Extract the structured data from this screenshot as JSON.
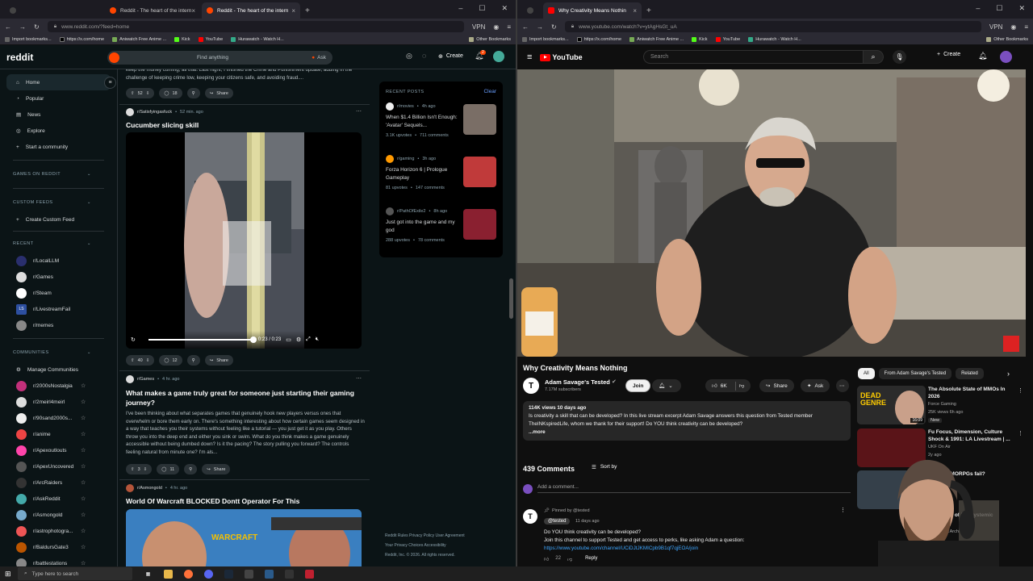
{
  "left_browser": {
    "tabs": [
      {
        "title": "Reddit - The heart of the intern"
      },
      {
        "title": "Reddit - The heart of the intern"
      }
    ],
    "url": "www.reddit.com/?feed=home",
    "vpn": "VPN",
    "bookmarks": [
      "Import bookmarks...",
      "https://x.com/home",
      "Aniwatch Free Anime ...",
      "Kick",
      "YouTube",
      "Hurawatch - Watch H..."
    ],
    "other_bookmarks": "Other Bookmarks"
  },
  "reddit": {
    "logo": "reddit",
    "search_placeholder": "Find anything",
    "ask_label": "Ask",
    "create_label": "Create",
    "notif_count": "2",
    "nav": [
      {
        "label": "Home",
        "icon": "home-icon"
      },
      {
        "label": "Popular",
        "icon": "popular-icon"
      },
      {
        "label": "News",
        "icon": "news-icon"
      },
      {
        "label": "Explore",
        "icon": "explore-icon"
      },
      {
        "label": "Start a community",
        "icon": "plus-icon"
      }
    ],
    "sections": {
      "games": "GAMES ON REDDIT",
      "custom": "CUSTOM FEEDS",
      "create_feed": "Create Custom Feed",
      "recent": "RECENT",
      "communities": "COMMUNITIES",
      "manage": "Manage Communities"
    },
    "recent_subs": [
      "r/LocalLLM",
      "r/Games",
      "r/Steam",
      "r/LivestreamFail",
      "r/memes"
    ],
    "communities": [
      "r/2000sNostalgia",
      "r/2meirl4meirl",
      "r/90sand2000s...",
      "r/anime",
      "r/Apexoutlouts",
      "r/ApexUncovered",
      "r/ArcRaiders",
      "r/AskReddit",
      "r/Asmongold",
      "r/astrophotogra...",
      "r/BaldursGate3",
      "r/battlestations"
    ],
    "posts": [
      {
        "text": "keep the money coming, all that. Last night, I finished the Crime and Punishment update, adding in the challenge of keeping crime low, keeping your citizens safe, and avoiding fraud....",
        "votes": "52",
        "comments": "18",
        "share": "Share"
      },
      {
        "sub": "r/Satisfyingasfuck",
        "time": "52 min. ago",
        "title": "Cucumber slicing skill",
        "video_time": "0:23 / 0:23",
        "progress": 1.0,
        "votes": "40",
        "comments": "12",
        "share": "Share"
      },
      {
        "sub": "r/Games",
        "time": "4 hr. ago",
        "title": "What makes a game truly great for someone just starting their gaming journey?",
        "text": "I've been thinking about what separates games that genuinely hook new players versus ones that overwhelm or bore them early on. There's something interesting about how certain games seem designed in a way that teaches you their systems without feeling like a tutorial — you just get it as you play. Others throw you into the deep end and either you sink or swim. What do you think makes a game genuinely accessible without being dumbed down? Is it the pacing? The story pulling you forward? The controls feeling natural from minute one? I'm als...",
        "votes": "3",
        "comments": "11",
        "share": "Share"
      },
      {
        "sub": "r/Asmongold",
        "time": "4 hr. ago",
        "title": "World Of Warcraft BLOCKED Dontt Operator For This",
        "thumb_text": "WARCRAFT"
      }
    ],
    "recent_panel": {
      "heading": "RECENT POSTS",
      "clear": "Clear",
      "items": [
        {
          "sub": "r/movies",
          "time": "4h ago",
          "title": "When $1.4 Billion Isn't Enough: 'Avatar' Sequels...",
          "upvotes": "3.1K upvotes",
          "comments": "711 comments"
        },
        {
          "sub": "r/gaming",
          "time": "3h ago",
          "title": "Forza Horizon 6 | Prologue Gameplay",
          "upvotes": "81 upvotes",
          "comments": "147 comments"
        },
        {
          "sub": "r/PathOfExile2",
          "time": "8h ago",
          "title": "Just got into the game and my god",
          "upvotes": "288 upvotes",
          "comments": "78 comments"
        }
      ]
    },
    "footer": {
      "line1": "Reddit Rules  Privacy Policy  User Agreement",
      "line2": "Your Privacy Choices  Accessibility",
      "line3": "Reddit, Inc. © 2026. All rights reserved."
    }
  },
  "right_browser": {
    "tabs": [
      {
        "title": "Why Creativity Means Nothin"
      }
    ],
    "url": "www.youtube.com/watch?v=ytAgHsGt_uA",
    "vpn": "VPN"
  },
  "youtube": {
    "logo": "YouTube",
    "search_placeholder": "Search",
    "create_label": "Create",
    "title": "Why Creativity Means Nothing",
    "channel": "Adam Savage's Tested",
    "subscribers": "7.17M subscribers",
    "join": "Join",
    "likes": "6K",
    "share": "Share",
    "ask": "Ask",
    "desc_meta": "114K views  10 days ago",
    "desc_text": "Is creativity a skill that can be developed? In this live stream excerpt Adam Savage answers this question from Tested member TheINKspiredLife, whom we thank for their support! Do YOU think creativity can be developed?",
    "more": "...more",
    "comments_count": "439 Comments",
    "sort_by": "Sort by",
    "add_comment": "Add a comment...",
    "pinned_by": "Pinned by @tested",
    "comment_author": "@tested",
    "comment_time": "11 days ago",
    "comment_line1": "Do YOU think creativity can be developed?",
    "comment_line2": "Join this channel to support Tested and get access to perks, like asking Adam a question:",
    "comment_link": "https://www.youtube.com/channel/UCiDJtJKMICpb9B1qf7qjEOA/join",
    "comment_likes": "22",
    "reply": "Reply",
    "chips": [
      {
        "label": "All"
      },
      {
        "label": "From Adam Savage's Tested"
      },
      {
        "label": "Related"
      }
    ],
    "related": [
      {
        "title": "The Absolute State of MMOs In 2026",
        "channel": "Force Gaming",
        "meta": "25K views  6h ago",
        "badge": "New",
        "duration": "16:09",
        "thumb_text": "DEAD GENRE"
      },
      {
        "title": "Fu Focus, Dimension, Culture Shock & 1991: LA Livestream | ...",
        "channel": "UKF On Air",
        "meta": "2y ago",
        "badge": ""
      },
      {
        "title": "MMORPGs fail?",
        "channel": "",
        "meta": "",
        "badge": ""
      },
      {
        "title": "...y of Ecosystemic",
        "channel": "...Archive",
        "meta": "",
        "badge": ""
      }
    ]
  },
  "taskbar": {
    "search": "Type here to search"
  }
}
